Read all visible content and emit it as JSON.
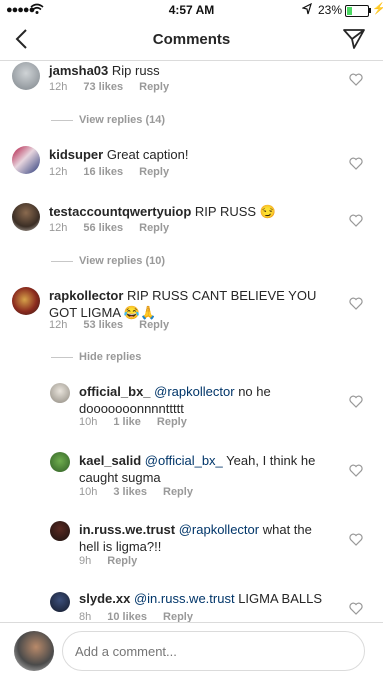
{
  "status": {
    "time": "4:57 AM",
    "battery": "23%"
  },
  "header": {
    "title": "Comments"
  },
  "comments": [
    {
      "user": "jamsha03",
      "text": "Rip russ",
      "time": "12h",
      "likes": "73 likes",
      "reply": "Reply"
    },
    {
      "user": "kidsuper",
      "text": "Great caption!",
      "time": "12h",
      "likes": "16 likes",
      "reply": "Reply"
    },
    {
      "user": "testaccountqwertyuiop",
      "text": "RIP RUSS",
      "emoji": "😏",
      "time": "12h",
      "likes": "56 likes",
      "reply": "Reply"
    },
    {
      "user": "rapkollector",
      "text": "RIP RUSS CANT BELIEVE YOU GOT LIGMA",
      "emoji": "😂🙏",
      "time": "12h",
      "likes": "53 likes",
      "reply": "Reply"
    }
  ],
  "view_replies_1": "View replies (14)",
  "view_replies_2": "View replies (10)",
  "hide_replies": "Hide replies",
  "replies": [
    {
      "user": "official_bx_",
      "mention": "@rapkollector",
      "text": "no he dooooooonnnnttttt",
      "time": "10h",
      "likes": "1 like",
      "reply": "Reply"
    },
    {
      "user": "kael_salid",
      "mention": "@official_bx_",
      "text": "Yeah, I think he caught sugma",
      "time": "10h",
      "likes": "3 likes",
      "reply": "Reply"
    },
    {
      "user": "in.russ.we.trust",
      "mention": "@rapkollector",
      "text": "what the hell is ligma?!!",
      "time": "9h",
      "reply": "Reply"
    },
    {
      "user": "slyde.xx",
      "mention": "@in.russ.we.trust",
      "text": "LIGMA BALLS",
      "time": "8h",
      "likes": "10 likes",
      "reply": "Reply"
    }
  ],
  "composer": {
    "placeholder": "Add a comment..."
  },
  "colors": {
    "mention": "#003569",
    "meta": "#999999",
    "divider": "#dbdbdb"
  }
}
